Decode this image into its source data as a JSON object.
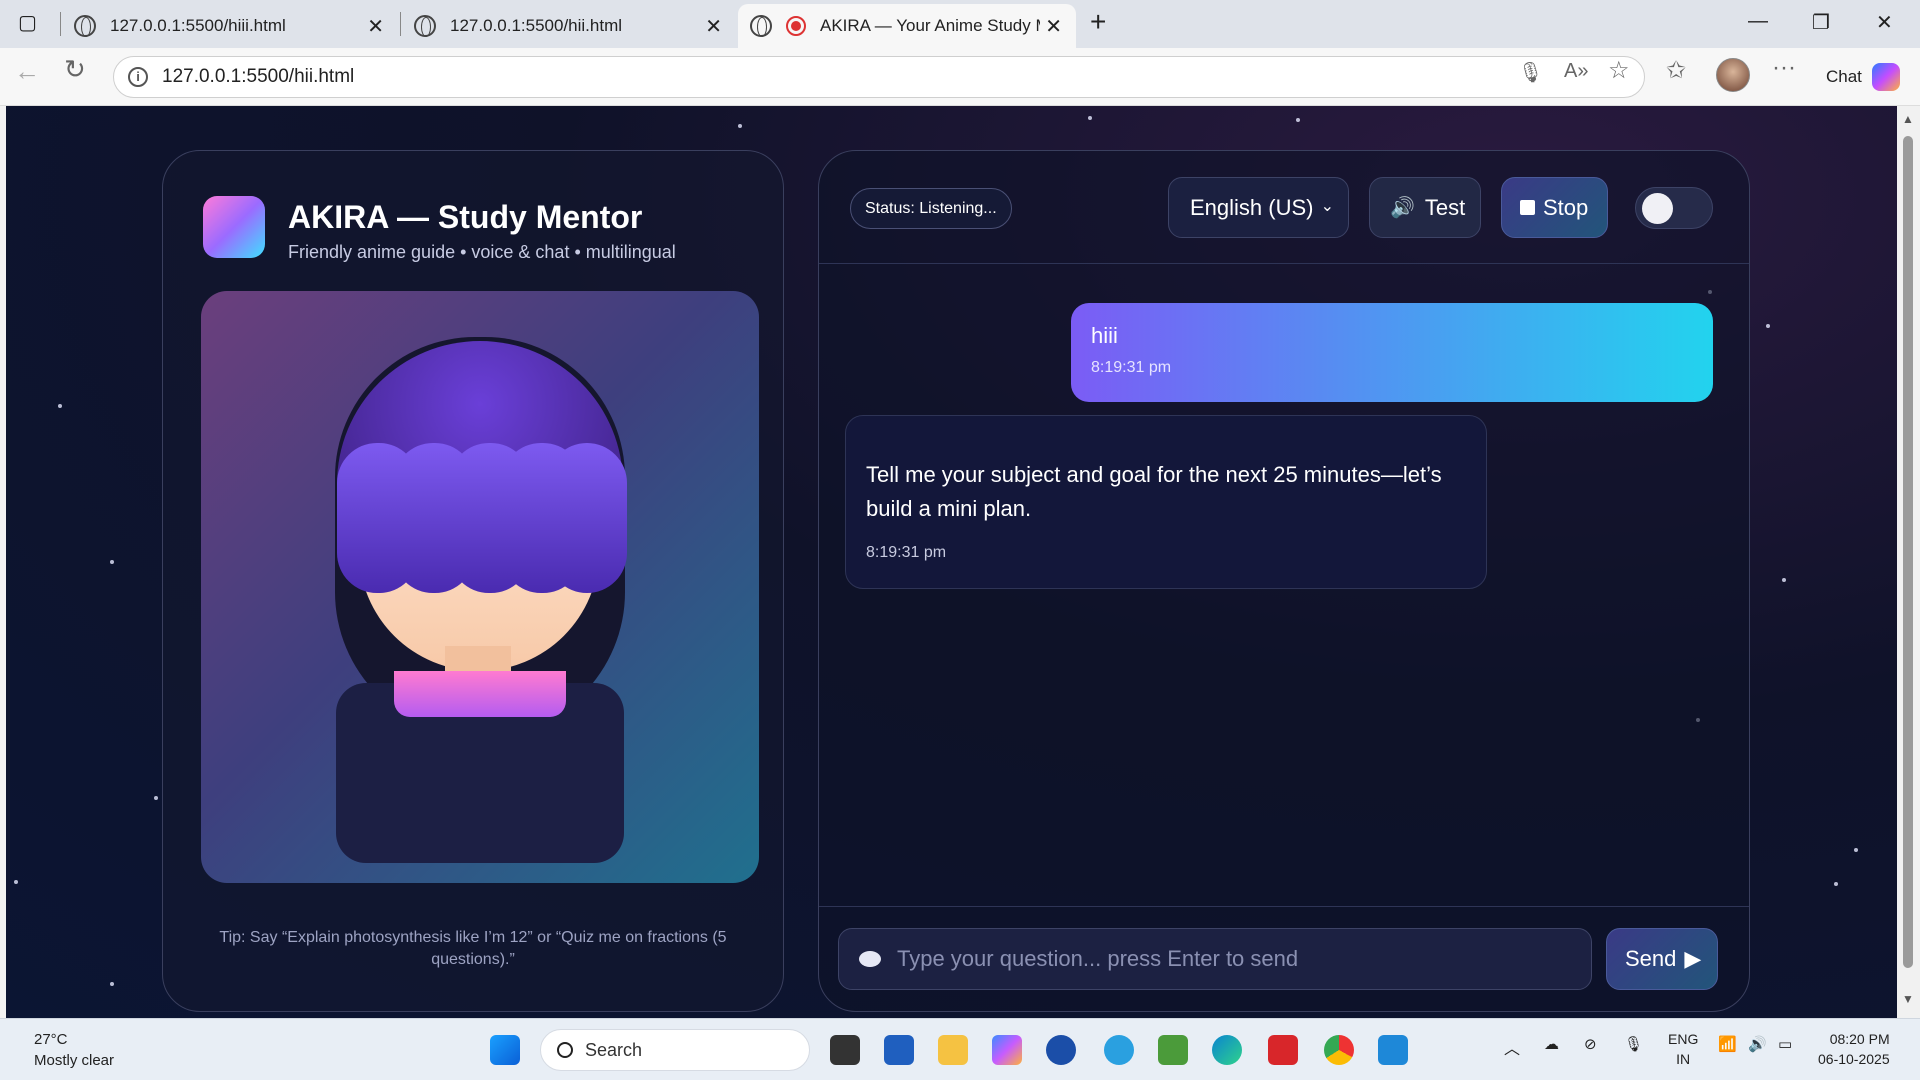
{
  "browser": {
    "tabs": [
      {
        "label": "127.0.0.1:5500/hiii.html"
      },
      {
        "label": "127.0.0.1:5500/hii.html"
      },
      {
        "label": "AKIRA — Your Anime Study M"
      }
    ],
    "url": "127.0.0.1:5500/hii.html",
    "chat_label": "Chat"
  },
  "app": {
    "title": "AKIRA — Study Mentor",
    "subtitle": "Friendly anime guide • voice & chat • multilingual",
    "tip": "Tip: Say “Explain photosynthesis like I’m 12” or “Quiz me on fractions (5 questions).”",
    "status": "Status: Listening...",
    "language": "English (US)",
    "test_label": "Test",
    "stop_label": "Stop",
    "input_placeholder": "Type your question... press Enter to send",
    "send_label": "Send",
    "messages": [
      {
        "role": "user",
        "text": "hiii",
        "time": "8:19:31 pm"
      },
      {
        "role": "bot",
        "text": "Tell me your subject and goal for the next 25 minutes—let’s build a mini plan.",
        "time": "8:19:31 pm"
      }
    ]
  },
  "taskbar": {
    "temperature": "27°C",
    "weather": "Mostly clear",
    "search": "Search",
    "lang_line1": "ENG",
    "lang_line2": "IN",
    "time": "08:20 PM",
    "date": "06-10-2025"
  }
}
